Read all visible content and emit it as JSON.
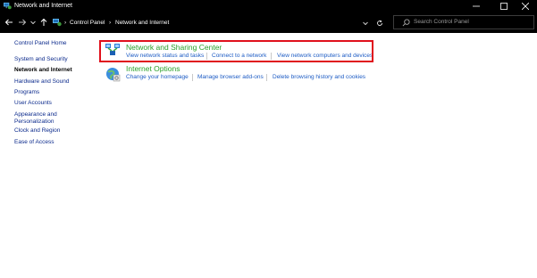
{
  "window": {
    "title": "Network and Internet",
    "controls": [
      "minimize-icon",
      "maximize-icon",
      "close-icon"
    ]
  },
  "address_bar": {
    "breadcrumbs": [
      "Control Panel",
      "Network and Internet"
    ],
    "search_placeholder": "Search Control Panel"
  },
  "sidebar": {
    "items": [
      {
        "label": "Control Panel Home",
        "current": false
      },
      {
        "label": "System and Security",
        "current": false
      },
      {
        "label": "Network and Internet",
        "current": true
      },
      {
        "label": "Hardware and Sound",
        "current": false
      },
      {
        "label": "Programs",
        "current": false
      },
      {
        "label": "User Accounts",
        "current": false
      },
      {
        "label": "Appearance and Personalization",
        "current": false
      },
      {
        "label": "Clock and Region",
        "current": false
      },
      {
        "label": "Ease of Access",
        "current": false
      }
    ]
  },
  "categories": [
    {
      "title": "Network and Sharing Center",
      "icon": "network-sharing-icon",
      "links": [
        "View network status and tasks",
        "Connect to a network",
        "View network computers and devices"
      ]
    },
    {
      "title": "Internet Options",
      "icon": "internet-options-icon",
      "links": [
        "Change your homepage",
        "Manage browser add-ons",
        "Delete browsing history and cookies"
      ]
    }
  ],
  "colors": {
    "titlebar_bg": "#000000",
    "category_title": "#2aa02a",
    "link": "#1c5bc4",
    "highlight_border": "#e0101c"
  }
}
